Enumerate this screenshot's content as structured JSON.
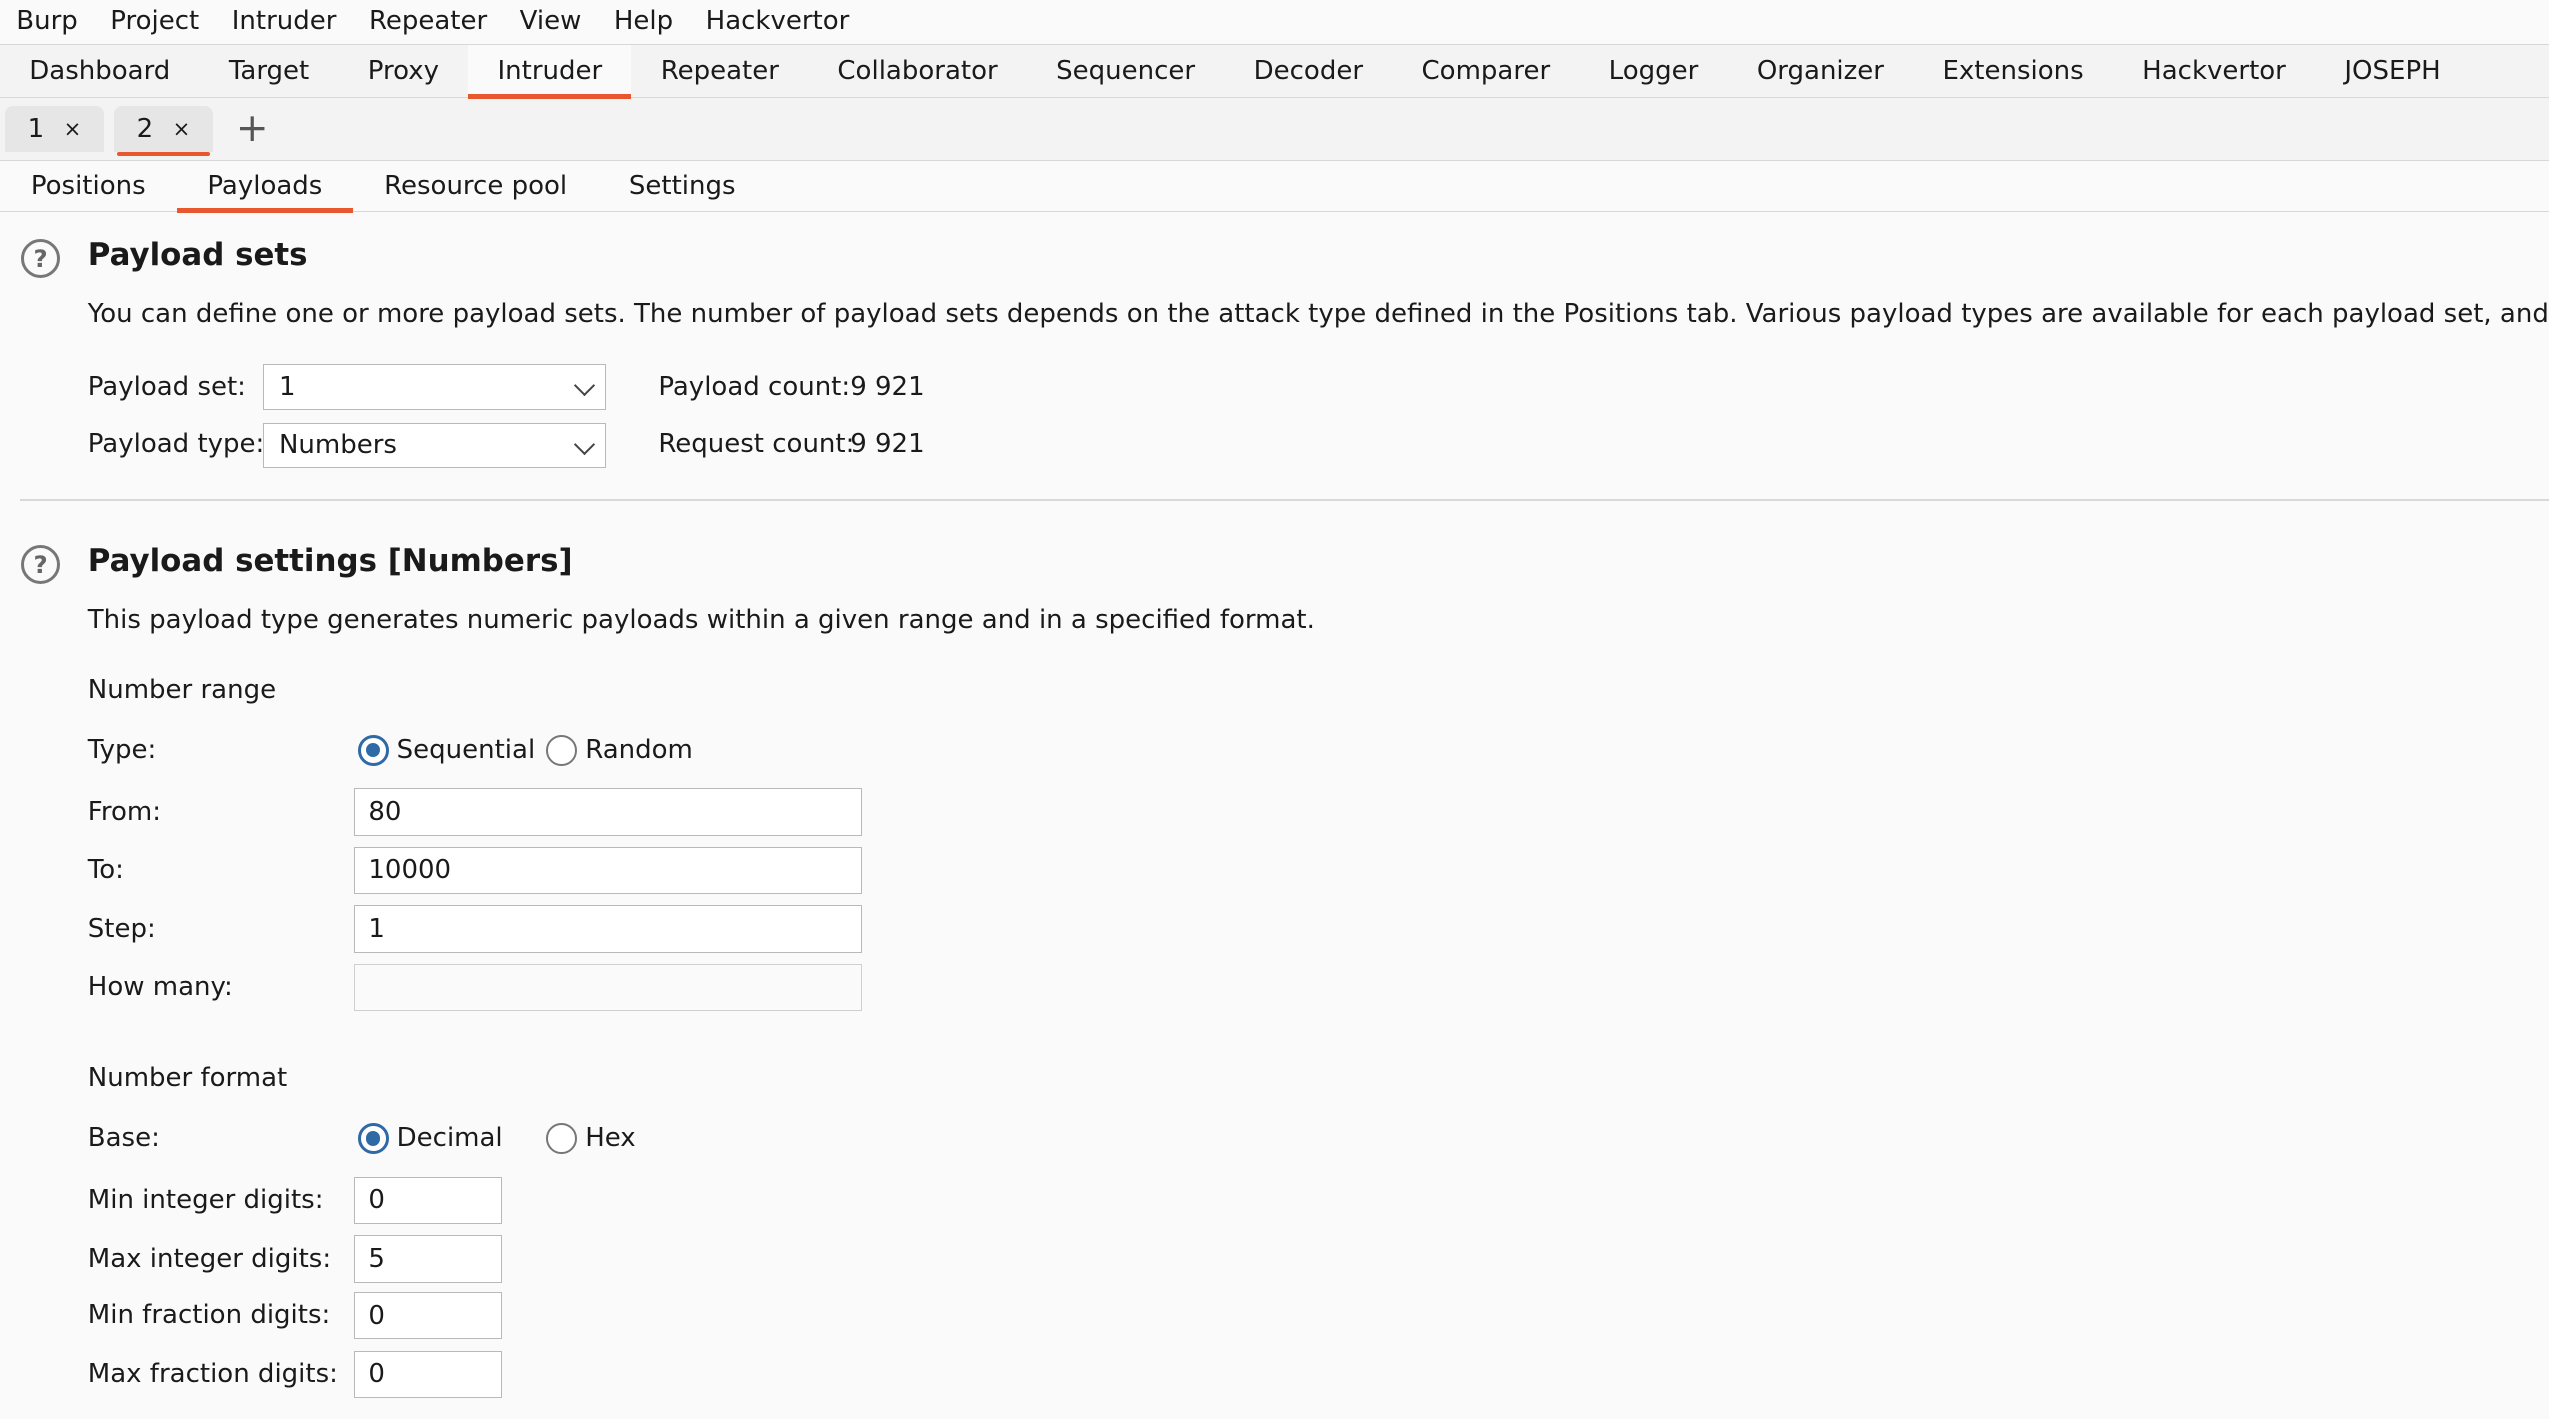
{
  "menubar": [
    "Burp",
    "Project",
    "Intruder",
    "Repeater",
    "View",
    "Help",
    "Hackvertor"
  ],
  "main_tabs": [
    {
      "label": "Dashboard",
      "active": false
    },
    {
      "label": "Target",
      "active": false
    },
    {
      "label": "Proxy",
      "active": false
    },
    {
      "label": "Intruder",
      "active": true
    },
    {
      "label": "Repeater",
      "active": false
    },
    {
      "label": "Collaborator",
      "active": false
    },
    {
      "label": "Sequencer",
      "active": false
    },
    {
      "label": "Decoder",
      "active": false
    },
    {
      "label": "Comparer",
      "active": false
    },
    {
      "label": "Logger",
      "active": false
    },
    {
      "label": "Organizer",
      "active": false
    },
    {
      "label": "Extensions",
      "active": false
    },
    {
      "label": "Hackvertor",
      "active": false
    },
    {
      "label": "JOSEPH",
      "active": false
    }
  ],
  "attack_tabs": [
    {
      "label": "1",
      "close": "×",
      "active": false
    },
    {
      "label": "2",
      "close": "×",
      "active": true
    }
  ],
  "add_tab": "+",
  "inner_tabs": [
    {
      "label": "Positions",
      "active": false
    },
    {
      "label": "Payloads",
      "active": true
    },
    {
      "label": "Resource pool",
      "active": false
    },
    {
      "label": "Settings",
      "active": false
    }
  ],
  "payload_sets": {
    "help": "?",
    "title": "Payload sets",
    "description": "You can define one or more payload sets. The number of payload sets depends on the attack type defined in the Positions tab. Various payload types are available for each payload set, and each payloa",
    "payload_set_label": "Payload set:",
    "payload_set_value": "1",
    "payload_type_label": "Payload type:",
    "payload_type_value": "Numbers",
    "payload_count_label": "Payload count:",
    "payload_count_value": "9 921",
    "request_count_label": "Request count:",
    "request_count_value": "9 921"
  },
  "payload_settings": {
    "help": "?",
    "title": "Payload settings [Numbers]",
    "description": "This payload type generates numeric payloads within a given range and in a specified format.",
    "number_range_heading": "Number range",
    "type_label": "Type:",
    "type_options": [
      {
        "label": "Sequential",
        "checked": true
      },
      {
        "label": "Random",
        "checked": false
      }
    ],
    "from_label": "From:",
    "from_value": "80",
    "to_label": "To:",
    "to_value": "10000",
    "step_label": "Step:",
    "step_value": "1",
    "how_many_label": "How many:",
    "how_many_value": "",
    "number_format_heading": "Number format",
    "base_label": "Base:",
    "base_options": [
      {
        "label": "Decimal",
        "checked": true
      },
      {
        "label": "Hex",
        "checked": false
      }
    ],
    "min_int_label": "Min integer digits:",
    "min_int_value": "0",
    "max_int_label": "Max integer digits:",
    "max_int_value": "5",
    "min_frac_label": "Min fraction digits:",
    "min_frac_value": "0",
    "max_frac_label": "Max fraction digits:",
    "max_frac_value": "0"
  },
  "colors": {
    "accent": "#e8572e",
    "radio": "#2f6aa7"
  }
}
